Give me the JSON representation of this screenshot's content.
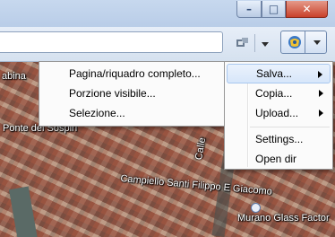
{
  "window": {
    "minimize_glyph": "–",
    "maximize_glyph": "□",
    "close_glyph": "✕"
  },
  "map": {
    "labels": [
      "abina",
      "Ponte dei Sospiri",
      "Calle",
      "Campiello Santi Filippo E Giacomo",
      "Murano Glass Factor"
    ]
  },
  "main_menu": {
    "items": [
      {
        "label": "Salva...",
        "submenu": true
      },
      {
        "label": "Copia...",
        "submenu": true
      },
      {
        "label": "Upload...",
        "submenu": true
      },
      {
        "label": "Settings...",
        "submenu": false
      },
      {
        "label": "Open dir",
        "submenu": false
      }
    ]
  },
  "submenu": {
    "items": [
      {
        "label": "Pagina/riquadro completo..."
      },
      {
        "label": "Porzione visibile..."
      },
      {
        "label": "Selezione..."
      }
    ]
  },
  "colors": {
    "hover_bg": "#d7e6fa",
    "close_red": "#c9412b",
    "menu_bg": "#fbfbfb"
  },
  "icons": [
    "minimize-icon",
    "maximize-icon",
    "close-icon",
    "compatibility-icon",
    "dropdown-arrow-icon",
    "screenshot-extension-icon"
  ]
}
